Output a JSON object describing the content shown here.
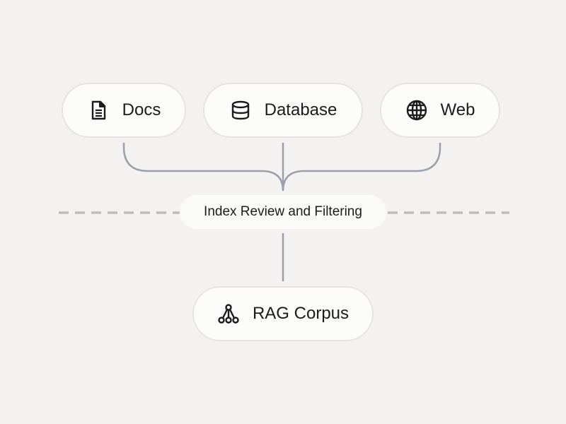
{
  "diagram": {
    "sources": [
      {
        "label": "Docs",
        "icon": "document-icon"
      },
      {
        "label": "Database",
        "icon": "database-icon"
      },
      {
        "label": "Web",
        "icon": "globe-icon"
      }
    ],
    "stage": {
      "label": "Index Review and Filtering"
    },
    "output": {
      "label": "RAG Corpus",
      "icon": "network-tree-icon"
    }
  },
  "colors": {
    "background": "#f3f2f1",
    "node_fill": "#fcfcfb",
    "node_border": "#e4e3e1",
    "connector": "#9aa0ab",
    "dashed_line": "#bdbdbd",
    "text": "#1b1b1d"
  }
}
